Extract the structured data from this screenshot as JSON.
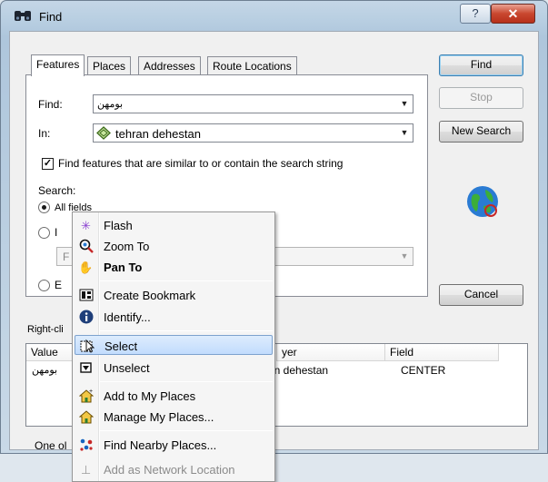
{
  "window": {
    "title": "Find",
    "help_glyph": "?",
    "close_glyph": "✕"
  },
  "tabs": [
    "Features",
    "Places",
    "Addresses",
    "Route Locations"
  ],
  "form": {
    "find_label": "Find:",
    "find_value": "بومهن",
    "in_label": "In:",
    "in_value": "tehran dehestan",
    "similar_checkbox": {
      "label": "Find features that are similar to or contain the search string",
      "checked": true
    },
    "search_label": "Search:",
    "radio_all_fields": "All fields",
    "radio_in_partial": "I",
    "radio_e_partial": "E",
    "field_combo_partial": "F"
  },
  "buttons": {
    "find": "Find",
    "stop": "Stop",
    "new_search": "New Search",
    "cancel": "Cancel"
  },
  "results": {
    "hint_partial": "Right-cli",
    "columns": [
      "Value",
      "yer",
      "Field"
    ],
    "rows": [
      {
        "value": "بومهن",
        "layer": "ran dehestan",
        "field": "CENTER"
      }
    ],
    "status_partial": "One ol"
  },
  "context_menu": {
    "items": [
      {
        "label": "Flash",
        "icon": "flash-icon"
      },
      {
        "label": "Zoom To",
        "icon": "zoom-to-icon"
      },
      {
        "label": "Pan To",
        "icon": "pan-hand-icon",
        "bold": true
      },
      {
        "label": "Create Bookmark",
        "icon": "bookmark-icon"
      },
      {
        "label": "Identify...",
        "icon": "identify-icon"
      },
      {
        "label": "Select",
        "icon": "select-icon",
        "highlighted": true
      },
      {
        "label": "Unselect",
        "icon": "unselect-icon"
      },
      {
        "label": "Add to My Places",
        "icon": "add-place-icon"
      },
      {
        "label": "Manage My Places...",
        "icon": "manage-places-icon"
      },
      {
        "label": "Find Nearby Places...",
        "icon": "nearby-places-icon"
      },
      {
        "label": "Add as Network Location",
        "icon": "network-location-icon",
        "disabled": true
      }
    ]
  },
  "colors": {
    "menu_highlight": "#c2dcfd",
    "close_button": "#c9472f",
    "title_bar": "#b9cfe2"
  }
}
